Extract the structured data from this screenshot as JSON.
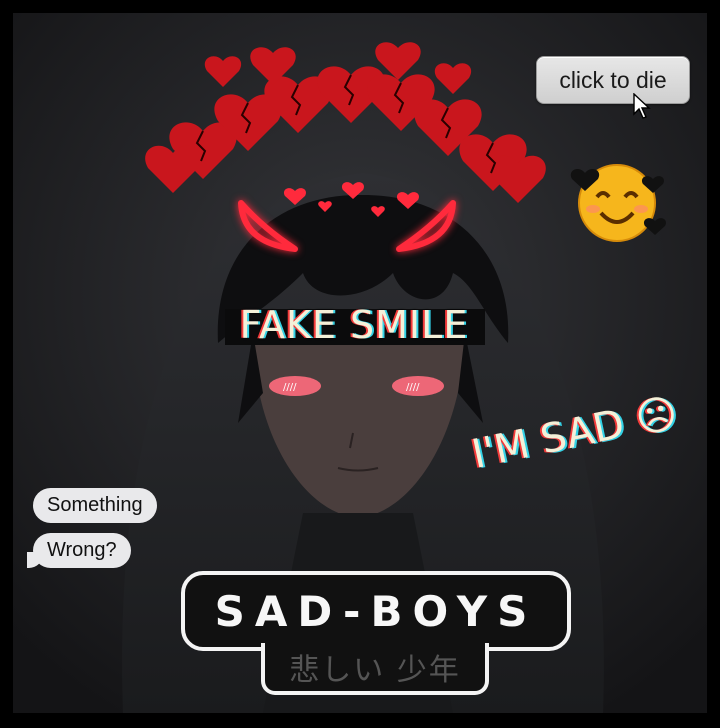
{
  "button": {
    "label": "click to die"
  },
  "overlay": {
    "fake_smile": "FAKE SMILE",
    "im_sad": "I'M SAD ☹"
  },
  "chat": {
    "bubble1": "Something",
    "bubble2": "Wrong?"
  },
  "logo": {
    "main": "SAD-BOYS",
    "sub": "悲しい 少年"
  },
  "icons": [
    "broken-heart-icon",
    "devil-horns-icon",
    "smiling-face-icon",
    "cursor-icon",
    "frown-icon"
  ],
  "colors": {
    "background": "#222326",
    "accent_red": "#d11d23",
    "neon_red": "#ff3344",
    "text_light": "#f4f0d8"
  }
}
